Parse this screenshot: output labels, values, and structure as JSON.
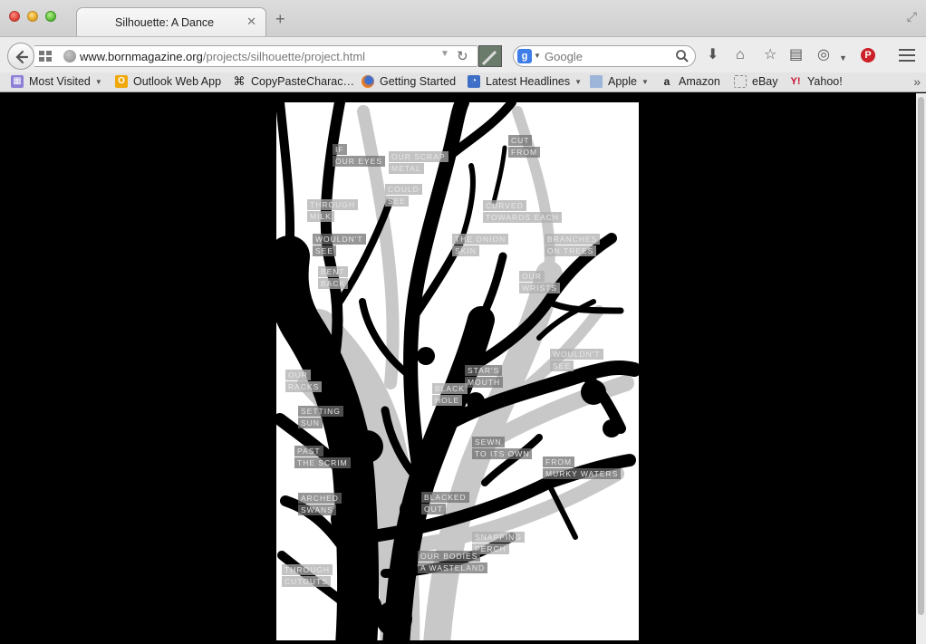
{
  "window": {
    "tab_title": "Silhouette: A Dance",
    "tab_close": "✕",
    "new_tab": "+",
    "fullscreen": "⤢"
  },
  "nav": {
    "url_host": "www.bornmagazine.org",
    "url_path": "/projects/silhouette/project.html",
    "search_placeholder": "Google",
    "search_engine_letter": "g",
    "pinterest_letter": "P",
    "icons": [
      "back-arrow-icon",
      "grid-icon",
      "globe-icon",
      "reload-icon",
      "download-icon",
      "home-icon",
      "star-icon",
      "clipboard-icon",
      "extension-icon",
      "pinterest-icon",
      "menu-icon"
    ]
  },
  "bookmarks": {
    "most_visited": "Most Visited",
    "outlook": "Outlook Web App",
    "copypaste": "CopyPasteCharac…",
    "getting_started": "Getting Started",
    "latest_headlines": "Latest Headlines",
    "apple": "Apple",
    "amazon": "Amazon",
    "ebay": "eBay",
    "yahoo": "Yahoo!",
    "more": "»"
  },
  "words": [
    {
      "lines": [
        "If",
        "our eyes"
      ],
      "tone": "dark"
    },
    {
      "lines": [
        "our scrap",
        "metal"
      ],
      "tone": "light"
    },
    {
      "lines": [
        "cut",
        "from"
      ],
      "tone": "dark"
    },
    {
      "lines": [
        "could",
        "see"
      ],
      "tone": "light"
    },
    {
      "lines": [
        "through",
        "milk"
      ],
      "tone": "light"
    },
    {
      "lines": [
        "curved",
        "towards each"
      ],
      "tone": "light"
    },
    {
      "lines": [
        "wouldn't",
        "see"
      ],
      "tone": "dark"
    },
    {
      "lines": [
        "the onion",
        "skin"
      ],
      "tone": "light"
    },
    {
      "lines": [
        "branches",
        "on trees"
      ],
      "tone": "light"
    },
    {
      "lines": [
        "bent",
        "back"
      ],
      "tone": "light"
    },
    {
      "lines": [
        "our",
        "wrists"
      ],
      "tone": "light"
    },
    {
      "lines": [
        "wouldn't",
        "see"
      ],
      "tone": "light"
    },
    {
      "lines": [
        "star's",
        "mouth"
      ],
      "tone": "dark"
    },
    {
      "lines": [
        "our",
        "racks"
      ],
      "tone": "light"
    },
    {
      "lines": [
        "black",
        "hole"
      ],
      "tone": "light"
    },
    {
      "lines": [
        "setting",
        "sun"
      ],
      "tone": "dark"
    },
    {
      "lines": [
        "sewn",
        "to its own"
      ],
      "tone": "dark"
    },
    {
      "lines": [
        "past",
        "the scrim"
      ],
      "tone": "dark"
    },
    {
      "lines": [
        "from",
        "murky waters"
      ],
      "tone": "dark"
    },
    {
      "lines": [
        "arched",
        "swans"
      ],
      "tone": "dark"
    },
    {
      "lines": [
        "blacked",
        "out"
      ],
      "tone": "dark"
    },
    {
      "lines": [
        "snapping",
        "perch"
      ],
      "tone": "light"
    },
    {
      "lines": [
        "our bodies",
        "a wasteland"
      ],
      "tone": "dark"
    },
    {
      "lines": [
        "through",
        "cutouts"
      ],
      "tone": "light"
    }
  ],
  "colors": {
    "page_bg": "#000000",
    "art_bg": "#ffffff",
    "tree": "#000000",
    "shadow": "#c8c8c8"
  }
}
